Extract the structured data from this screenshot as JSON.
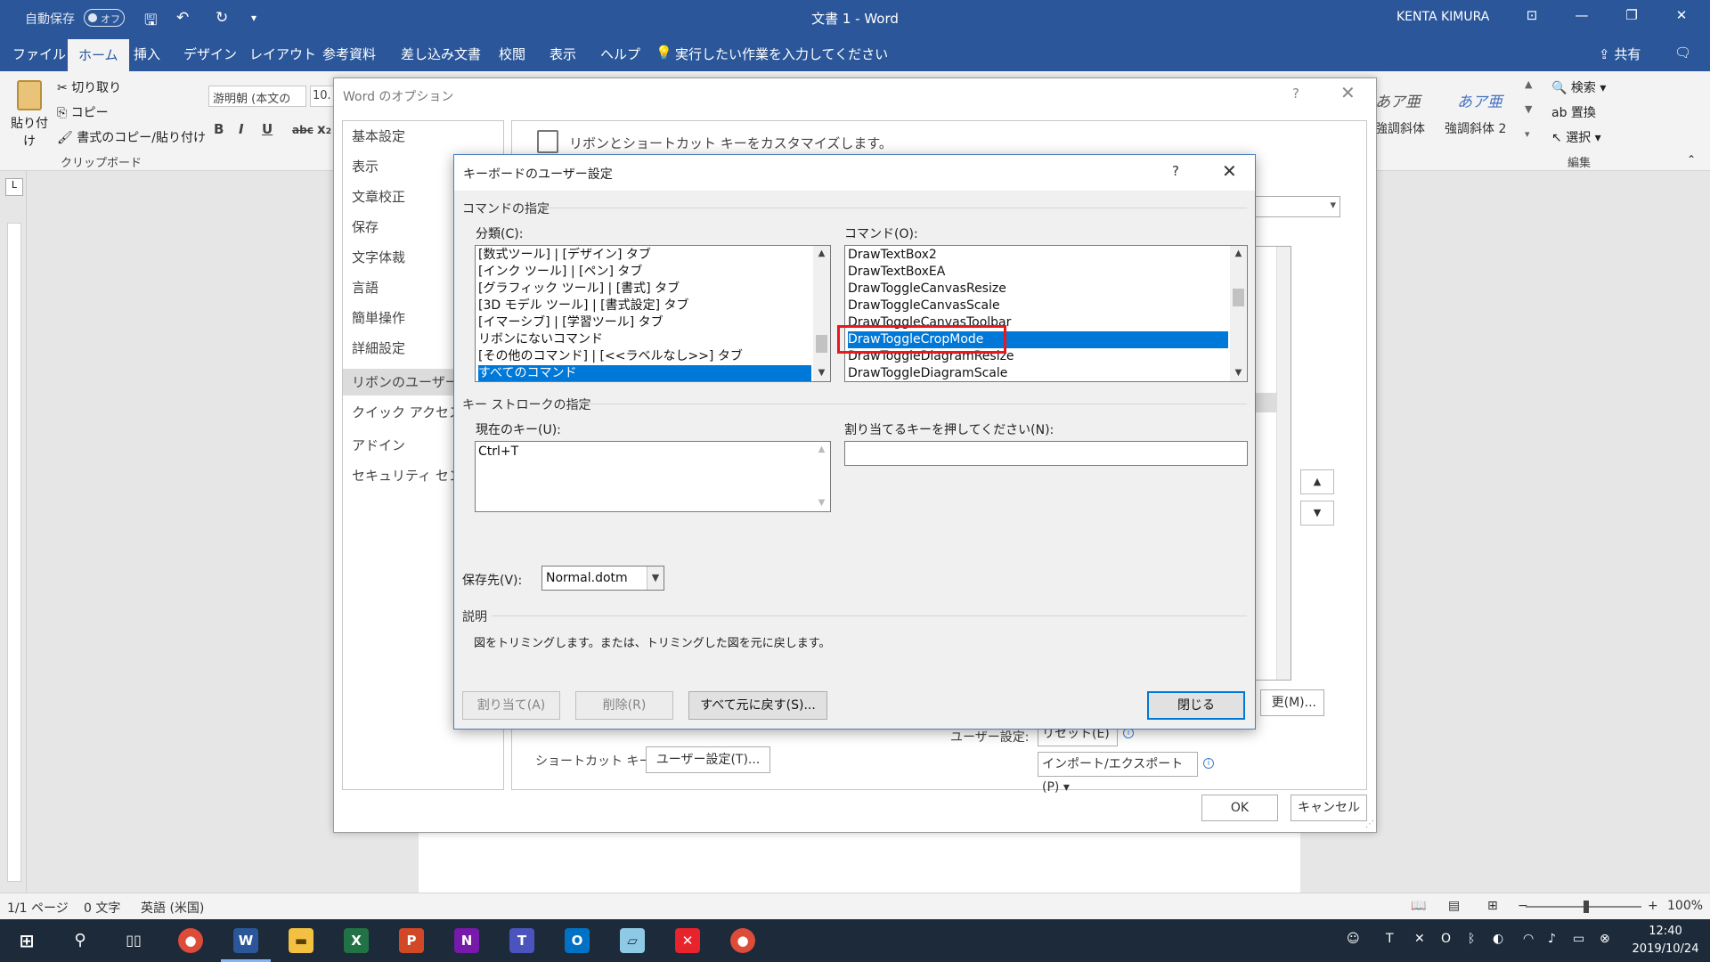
{
  "titlebar": {
    "autosave_label": "自動保存",
    "autosave_state": "オフ",
    "title": "文書 1  -  Word",
    "user": "KENTA KIMURA"
  },
  "menu": {
    "tabs": [
      "ファイル",
      "ホーム",
      "挿入",
      "デザイン",
      "レイアウト",
      "参考資料",
      "差し込み文書",
      "校閲",
      "表示",
      "ヘルプ"
    ],
    "active_tab": "ホーム",
    "tell_me": "実行したい作業を入力してください",
    "share": "共有"
  },
  "ribbon": {
    "paste": "貼り付け",
    "cut": "切り取り",
    "copy": "コピー",
    "format_painter": "書式のコピー/貼り付け",
    "clipboard_group": "クリップボード",
    "font_name": "游明朝 (本文の",
    "font_size": "10.",
    "fmt_bold": "B",
    "fmt_italic": "I",
    "fmt_underline": "U",
    "fmt_strike": "abc",
    "fmt_sub": "x₂",
    "style_sample_1": "あア亜",
    "style_sample_2": "あア亜",
    "style_name_1": "強調斜体",
    "style_name_2": "強調斜体 2",
    "find": "検索",
    "replace": "置換",
    "select": "選択",
    "edit_group": "編集"
  },
  "ruler": {
    "tab_marker": "L"
  },
  "statusbar": {
    "page": "1/1 ページ",
    "words": "0 文字",
    "language": "英語 (米国)",
    "zoom": "100%"
  },
  "taskbar": {
    "clock_time": "12:40",
    "clock_date": "2019/10/24"
  },
  "word_options": {
    "title": "Word のオプション",
    "help": "?",
    "close": "✕",
    "nav": [
      "基本設定",
      "表示",
      "文章校正",
      "保存",
      "文字体裁",
      "言語",
      "簡単操作",
      "詳細設定",
      "リボンのユーザー設定",
      "クイック アクセス ツー",
      "アドイン",
      "セキュリティ センター"
    ],
    "selected_nav": "リボンのユーザー設定",
    "heading": "リボンとショートカット キーをカスタマイズします。",
    "shortcut_label": "ショートカット キー:",
    "shortcut_button": "ユーザー設定(T)...",
    "user_settings_label": "ユーザー設定:",
    "reset_dropdown": "リセット(E) ▾",
    "import_export": "インポート/エクスポート(P) ▾",
    "rename_partial": "更(M)...",
    "ok": "OK",
    "cancel": "キャンセル"
  },
  "keyboard_dialog": {
    "title": "キーボードのユーザー設定",
    "help": "?",
    "close": "✕",
    "command_section": "コマンドの指定",
    "categories_label": "分類(C):",
    "categories": [
      "[数式ツール] | [デザイン] タブ",
      "[インク ツール] | [ペン] タブ",
      "[グラフィック ツール] | [書式] タブ",
      "[3D モデル ツール] | [書式設定] タブ",
      "[イマーシブ] | [学習ツール] タブ",
      "リボンにないコマンド",
      "[その他のコマンド] | [<<ラベルなし>>] タブ",
      "すべてのコマンド"
    ],
    "selected_category": "すべてのコマンド",
    "commands_label": "コマンド(O):",
    "commands": [
      "DrawTextBox2",
      "DrawTextBoxEA",
      "DrawToggleCanvasResize",
      "DrawToggleCanvasScale",
      "DrawToggleCanvasToolbar",
      "DrawToggleCropMode",
      "DrawToggleDiagramResize",
      "DrawToggleDiagramScale"
    ],
    "selected_command": "DrawToggleCropMode",
    "keystroke_section": "キー ストロークの指定",
    "current_keys_label": "現在のキー(U):",
    "current_keys": "Ctrl+T",
    "new_key_label": "割り当てるキーを押してください(N):",
    "new_key_value": "",
    "save_in_label": "保存先(V):",
    "save_in_value": "Normal.dotm",
    "description_label": "説明",
    "description": "図をトリミングします。または、トリミングした図を元に戻します。",
    "assign_button": "割り当て(A)",
    "remove_button": "削除(R)",
    "reset_all_button": "すべて元に戻す(S)...",
    "close_button": "閉じる"
  },
  "colors": {
    "word_blue": "#2b579a",
    "selection_blue": "#0078d7",
    "highlight_red": "#e8181c"
  }
}
